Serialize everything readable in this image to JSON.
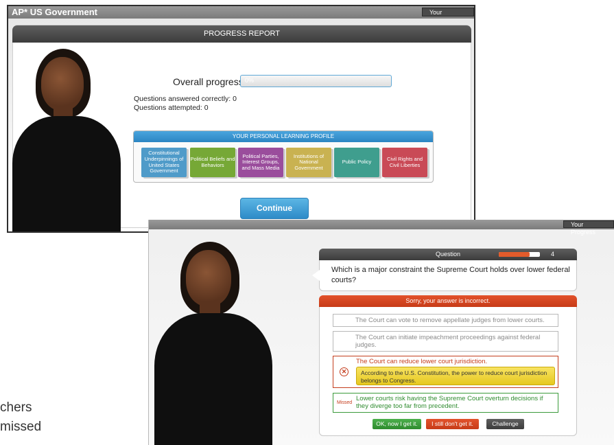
{
  "window1": {
    "app_title": "AP* US Government",
    "your_progress_label": "Your Progress",
    "report_title": "PROGRESS REPORT",
    "overall_progress_label": "Overall progress",
    "overall_progress_value": "0%",
    "overall_progress_fraction": 0,
    "questions_correct": "Questions answered correctly: 0",
    "questions_attempted": "Questions attempted: 0",
    "profile": {
      "title": "YOUR PERSONAL LEARNING PROFILE",
      "blocks": [
        {
          "label": "Constitutional Underpinnings of United States Government",
          "color": "#4f9bc9"
        },
        {
          "label": "Political Beliefs and Behaviors",
          "color": "#76a836"
        },
        {
          "label": "Political Parties, Interest Groups, and Mass Media",
          "color": "#9a4d9c"
        },
        {
          "label": "Institutions of National Government",
          "color": "#c9b251"
        },
        {
          "label": "Public Policy",
          "color": "#3f9e8e"
        },
        {
          "label": "Civil Rights and Civil Liberties",
          "color": "#c94a56"
        }
      ]
    },
    "continue_label": "Continue"
  },
  "window2": {
    "your_progress_label": "Your Progress",
    "question_label": "Question",
    "question_number": "4",
    "question_progress_fraction": 0.75,
    "question_text": "Which is a major constraint the Supreme Court holds over lower federal courts?",
    "feedback_title": "Sorry, your answer is incorrect.",
    "options": [
      {
        "text": "The Court can vote to remove appellate judges from lower courts."
      },
      {
        "text": "The Court can initiate impeachment proceedings against federal judges."
      }
    ],
    "wrong_option": {
      "text": "The Court can reduce lower court jurisdiction.",
      "explanation": "According to the U.S. Constitution, the power to reduce court jurisdiction belongs to Congress."
    },
    "missed_option": {
      "tag": "Missed",
      "text": "Lower courts risk having the Supreme Court overturn decisions if they diverge too far from precedent."
    },
    "buttons": {
      "ok": "OK, now I get it.",
      "still": "I still don't get it.",
      "challenge": "Challenge"
    }
  },
  "side_caption": [
    "chers",
    "missed"
  ],
  "colors": {
    "accent_blue": "#2e8bc8",
    "error_red": "#c43c1c",
    "success_green": "#3a9a3a"
  }
}
